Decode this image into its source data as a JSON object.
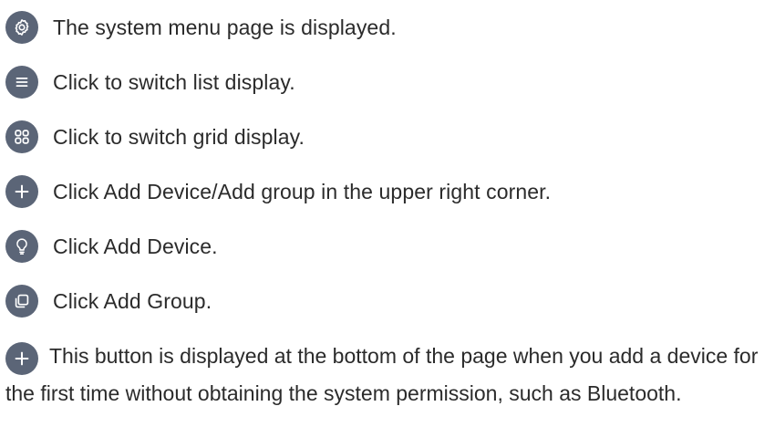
{
  "items": [
    {
      "icon": "settings-icon",
      "text": "The system menu page is displayed."
    },
    {
      "icon": "list-view-icon",
      "text": "Click to switch list display."
    },
    {
      "icon": "grid-view-icon",
      "text": "Click to switch grid display."
    },
    {
      "icon": "plus-icon",
      "text": "Click Add Device/Add group in the upper right corner."
    },
    {
      "icon": "lightbulb-icon",
      "text": "Click Add Device."
    },
    {
      "icon": "group-icon",
      "text": "Click Add Group."
    }
  ],
  "final": {
    "icon": "plus-icon",
    "text": "This button is displayed at the bottom of the page when you add a device for the first time without obtaining the system permission, such as Bluetooth."
  },
  "colors": {
    "icon_bg": "#5b6577",
    "icon_fg": "#ffffff",
    "text": "#2b2b2b"
  }
}
